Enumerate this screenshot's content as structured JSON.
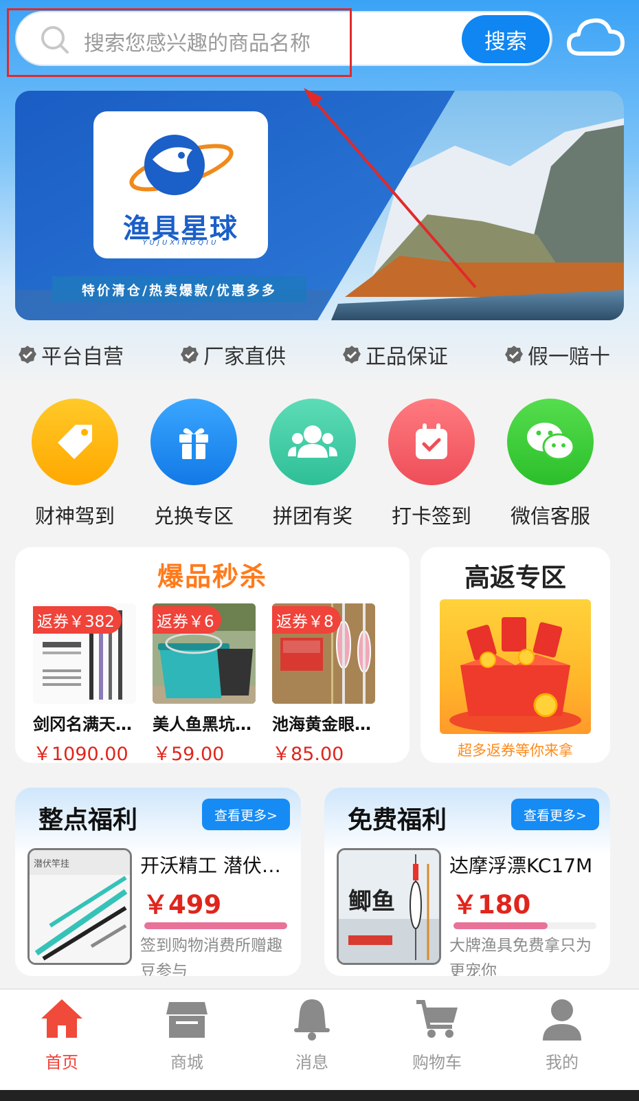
{
  "search": {
    "placeholder": "搜索您感兴趣的商品名称",
    "button_label": "搜索"
  },
  "banner": {
    "logo_title": "渔具星球",
    "logo_subtitle": "YUJUXINGQIU",
    "tagline": "特价清仓/热卖爆款/优惠多多"
  },
  "features": [
    {
      "label": "平台自营",
      "icon": "verified-badge-icon"
    },
    {
      "label": "厂家直供",
      "icon": "verified-badge-icon"
    },
    {
      "label": "正品保证",
      "icon": "verified-badge-icon"
    },
    {
      "label": "假一赔十",
      "icon": "verified-badge-icon"
    }
  ],
  "grid": [
    {
      "label": "财神驾到",
      "icon": "tag-icon",
      "color": "#ffb300"
    },
    {
      "label": "兑换专区",
      "icon": "gift-icon",
      "color": "#1e8ef0"
    },
    {
      "label": "拼团有奖",
      "icon": "group-icon",
      "color": "#3ccca4"
    },
    {
      "label": "打卡签到",
      "icon": "calendar-check-icon",
      "color": "#f5636a"
    },
    {
      "label": "微信客服",
      "icon": "wechat-icon",
      "color": "#3ecf3a"
    }
  ],
  "flash_sale": {
    "title": "爆品秒杀",
    "products": [
      {
        "coupon": "返券￥382",
        "name": "剑冈名满天下鱼竿",
        "price": "￥1090.00"
      },
      {
        "coupon": "返券￥6",
        "name": "美人鱼黑坑鱼桶",
        "price": "￥59.00"
      },
      {
        "coupon": "返券￥8",
        "name": "池海黄金眼浮漂",
        "price": "￥85.00"
      }
    ]
  },
  "rebate": {
    "title": "高返专区",
    "caption": "超多返券等你来拿"
  },
  "welfare": [
    {
      "title": "整点福利",
      "more": "查看更多>",
      "product_name": "开沃精工 潜伏竿挂",
      "price": "￥499",
      "progress": 1.0,
      "desc": "签到购物消费所赠趣豆参与",
      "image_text": "潜伏竿挂"
    },
    {
      "title": "免费福利",
      "more": "查看更多>",
      "product_name": "达摩浮漂KC17M",
      "price": "￥180",
      "progress": 0.66,
      "desc": "大牌渔具免费拿只为更宠你",
      "image_text": "鲫鱼"
    }
  ],
  "nav": [
    {
      "label": "首页",
      "icon": "home-icon",
      "active": true
    },
    {
      "label": "商城",
      "icon": "store-icon",
      "active": false
    },
    {
      "label": "消息",
      "icon": "bell-icon",
      "active": false
    },
    {
      "label": "购物车",
      "icon": "cart-icon",
      "active": false
    },
    {
      "label": "我的",
      "icon": "user-icon",
      "active": false
    }
  ],
  "colors": {
    "primary": "#168bf4",
    "price_red": "#e0251c",
    "coupon_red": "#f0433a",
    "flash_orange": "#ff7a1a",
    "annotation_red": "#e02a2a"
  }
}
